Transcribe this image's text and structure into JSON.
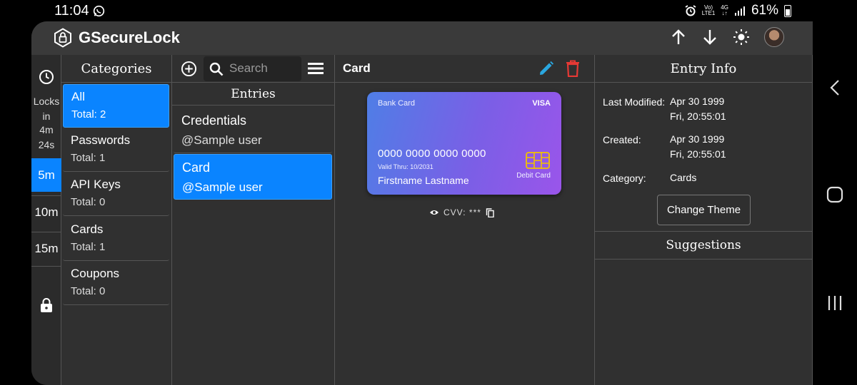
{
  "status_bar": {
    "time": "11:04",
    "battery_percent": "61%",
    "net_top": "Vo)",
    "net_bottom": "LTE1",
    "gen_top": "4G",
    "gen_bottom": "↓↑",
    "icons": [
      "whatsapp-icon",
      "alarm-icon",
      "signal-icon",
      "battery-icon"
    ]
  },
  "app": {
    "title": "GSecureLock",
    "appbar_icons": [
      "arrow-up-icon",
      "arrow-down-icon",
      "brightness-icon",
      "avatar"
    ]
  },
  "lock_rail": {
    "line1": "Locks",
    "line2": "in",
    "line3": "4m",
    "line4": "24s",
    "options": [
      "5m",
      "10m",
      "15m"
    ],
    "selected": "5m"
  },
  "categories": {
    "heading": "Categories",
    "items": [
      {
        "name": "All",
        "total": "Total: 2",
        "selected": true
      },
      {
        "name": "Passwords",
        "total": "Total: 1"
      },
      {
        "name": "API Keys",
        "total": "Total: 0"
      },
      {
        "name": "Cards",
        "total": "Total: 1"
      },
      {
        "name": "Coupons",
        "total": "Total: 0"
      }
    ]
  },
  "entries": {
    "search_placeholder": "Search",
    "heading": "Entries",
    "items": [
      {
        "title": "Credentials",
        "subtitle": "@Sample user"
      },
      {
        "title": "Card",
        "subtitle": "@Sample user",
        "selected": true
      }
    ]
  },
  "detail": {
    "title": "Card",
    "card": {
      "type_label": "Bank Card",
      "brand": "VISA",
      "number": "0000 0000 0000 0000",
      "valid_thru": "Valid Thru: 10/2031",
      "holder": "Firstname Lastname",
      "kind": "Debit Card"
    },
    "cvv_label": "CVV: ***",
    "colors": {
      "edit": "#2aa7e0",
      "delete": "#e53935",
      "card_from": "#4f7ee6",
      "card_to": "#9a55ea"
    }
  },
  "entry_info": {
    "heading": "Entry Info",
    "last_modified_label": "Last Modified:",
    "last_modified_date": "Apr 30 1999",
    "last_modified_time": "Fri, 20:55:01",
    "created_label": "Created:",
    "created_date": "Apr 30 1999",
    "created_time": "Fri, 20:55:01",
    "category_label": "Category:",
    "category_value": "Cards",
    "change_theme_label": "Change Theme",
    "suggestions_heading": "Suggestions"
  },
  "accent_color": "#0a84ff"
}
